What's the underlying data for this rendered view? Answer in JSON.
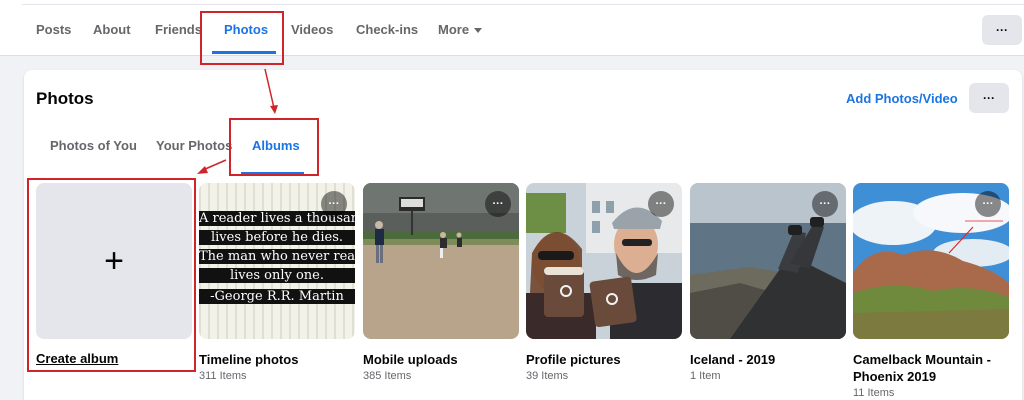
{
  "nav": {
    "tabs": [
      "Posts",
      "About",
      "Friends",
      "Photos",
      "Videos",
      "Check-ins",
      "More"
    ],
    "active": "Photos",
    "more_button": "···"
  },
  "photos": {
    "title": "Photos",
    "add_label": "Add Photos/Video",
    "more_button": "···",
    "tabs": [
      "Photos of You",
      "Your Photos",
      "Albums"
    ],
    "active_tab": "Albums"
  },
  "quote": [
    "A reader lives a thousand",
    "lives before he dies.",
    "The man who never reads",
    "lives only one.",
    "-George R.R. Martin"
  ],
  "create_album": {
    "label": "Create album",
    "icon": "+"
  },
  "albums": [
    {
      "name": "Timeline photos",
      "count": "311 Items"
    },
    {
      "name": "Mobile uploads",
      "count": "385 Items"
    },
    {
      "name": "Profile pictures",
      "count": "39 Items"
    },
    {
      "name": "Iceland - 2019",
      "count": "1 Item"
    },
    {
      "name": "Camelback Mountain - Phoenix 2019",
      "count": "11 Items"
    }
  ],
  "colors": {
    "accent": "#1b74e4",
    "annotation": "#d0242b",
    "page_bg": "#f0f2f5"
  }
}
